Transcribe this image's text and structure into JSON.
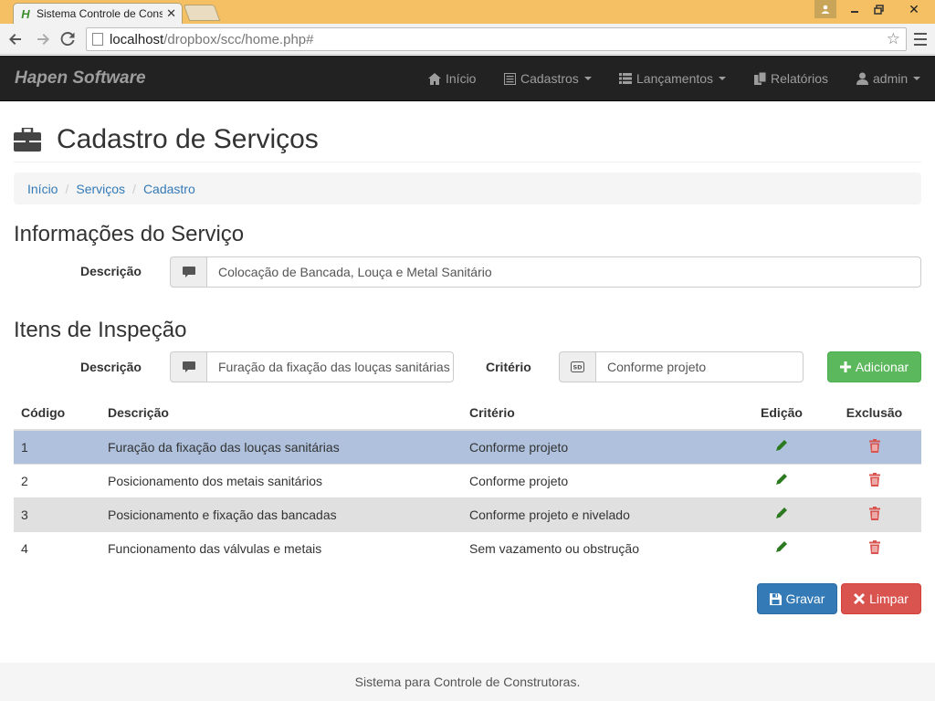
{
  "browser": {
    "tab_title": "Sistema Controle de Cons",
    "url_host": "localhost",
    "url_path": "/dropbox/scc/home.php#"
  },
  "navbar": {
    "brand": "Hapen Software",
    "items": [
      {
        "label": "Início",
        "icon": "home-icon"
      },
      {
        "label": "Cadastros",
        "icon": "list-alt-icon"
      },
      {
        "label": "Lançamentos",
        "icon": "th-list-icon"
      },
      {
        "label": "Relatórios",
        "icon": "copy-icon"
      },
      {
        "label": "admin",
        "icon": "user-icon"
      }
    ]
  },
  "page": {
    "title": "Cadastro de Serviços",
    "breadcrumb": [
      "Início",
      "Serviços",
      "Cadastro"
    ]
  },
  "service_info": {
    "title": "Informações do Serviço",
    "description_label": "Descrição",
    "description_value": "Colocação de Bancada, Louça e Metal Sanitário"
  },
  "inspection": {
    "title": "Itens de Inspeção",
    "description_label": "Descrição",
    "description_value": "Furação da fixação das louças sanitárias",
    "criterion_label": "Critério",
    "criterion_value": "Conforme projeto",
    "add_button": "Adicionar"
  },
  "table": {
    "headers": [
      "Código",
      "Descrição",
      "Critério",
      "Edição",
      "Exclusão"
    ],
    "rows": [
      {
        "code": "1",
        "description": "Furação da fixação das louças sanitárias",
        "criterion": "Conforme projeto"
      },
      {
        "code": "2",
        "description": "Posicionamento dos metais sanitários",
        "criterion": "Conforme projeto"
      },
      {
        "code": "3",
        "description": "Posicionamento e fixação das bancadas",
        "criterion": "Conforme projeto e nivelado"
      },
      {
        "code": "4",
        "description": "Funcionamento das válvulas e metais",
        "criterion": "Sem vazamento ou obstrução"
      }
    ]
  },
  "actions": {
    "save": "Gravar",
    "clear": "Limpar"
  },
  "footer": {
    "text": "Sistema para Controle de Construtoras."
  },
  "colors": {
    "navbar_bg": "#222222",
    "link": "#337ab7",
    "success": "#5cb85c",
    "primary": "#337ab7",
    "danger": "#d9534f",
    "selected_row": "#afc1dc"
  }
}
